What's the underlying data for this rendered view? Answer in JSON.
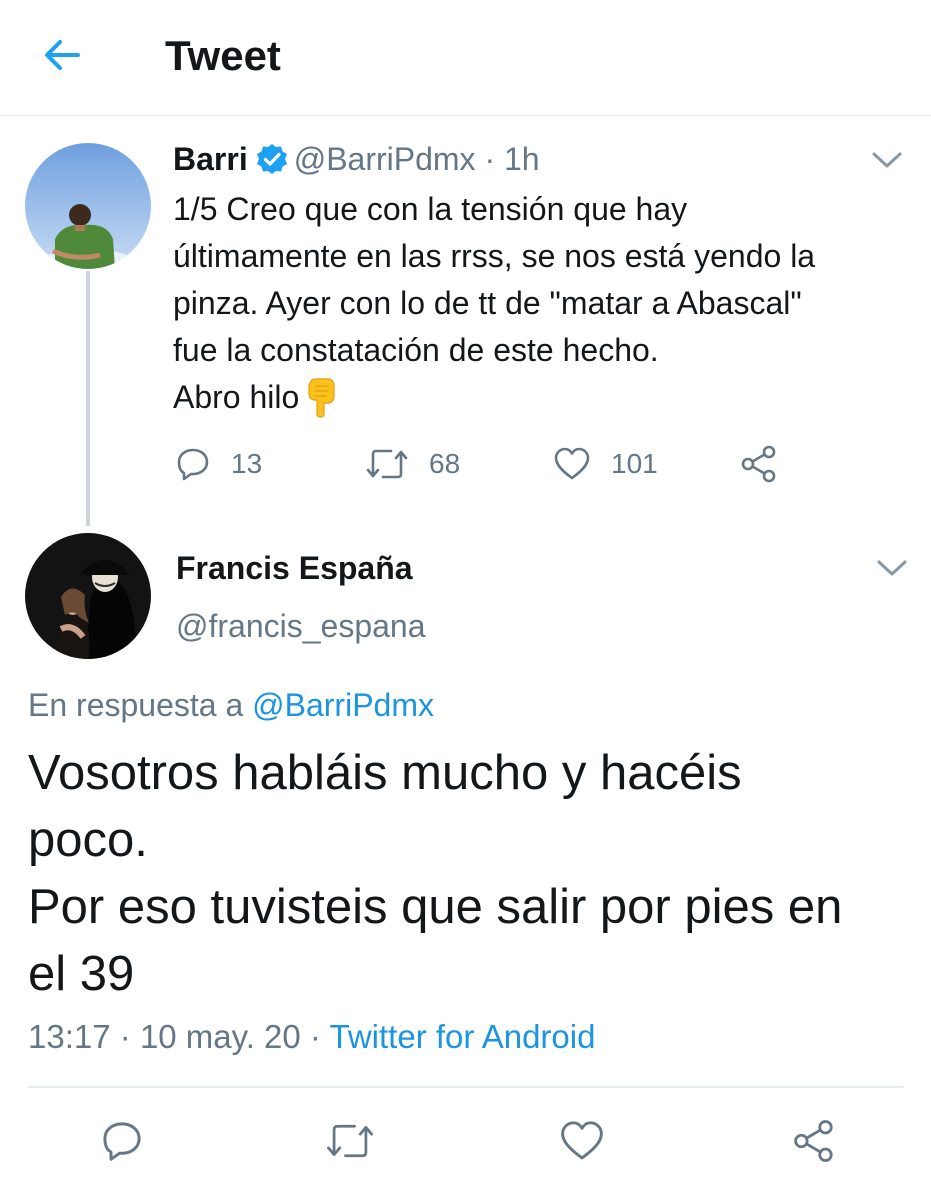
{
  "header": {
    "title": "Tweet"
  },
  "parent_tweet": {
    "name": "Barri",
    "handle": "@BarriPdmx",
    "dot": "·",
    "time": "1h",
    "lines": [
      "1/5 Creo que con la tensión que hay",
      "últimamente en las rrss, se nos está yendo la",
      "pinza. Ayer con lo de tt de \"matar a Abascal\"",
      "fue la constatación de este hecho.",
      "Abro hilo"
    ],
    "replies": "13",
    "retweets": "68",
    "likes": "101",
    "accent_blue": "#1da1f2",
    "muted_gray": "#657786"
  },
  "reply_tweet": {
    "name": "Francis España",
    "handle": "@francis_espana",
    "in_reply_to_label": "En respuesta a",
    "in_reply_to_handle": "@BarriPdmx",
    "lines": [
      "Vosotros habláis mucho y hacéis",
      "poco.",
      "Por eso tuvisteis que salir por pies en",
      "el 39"
    ],
    "time": "13:17",
    "sep1": "·",
    "date": "10 may. 20",
    "sep2": "·",
    "source": "Twitter for Android",
    "link_blue": "#1b95e0"
  }
}
